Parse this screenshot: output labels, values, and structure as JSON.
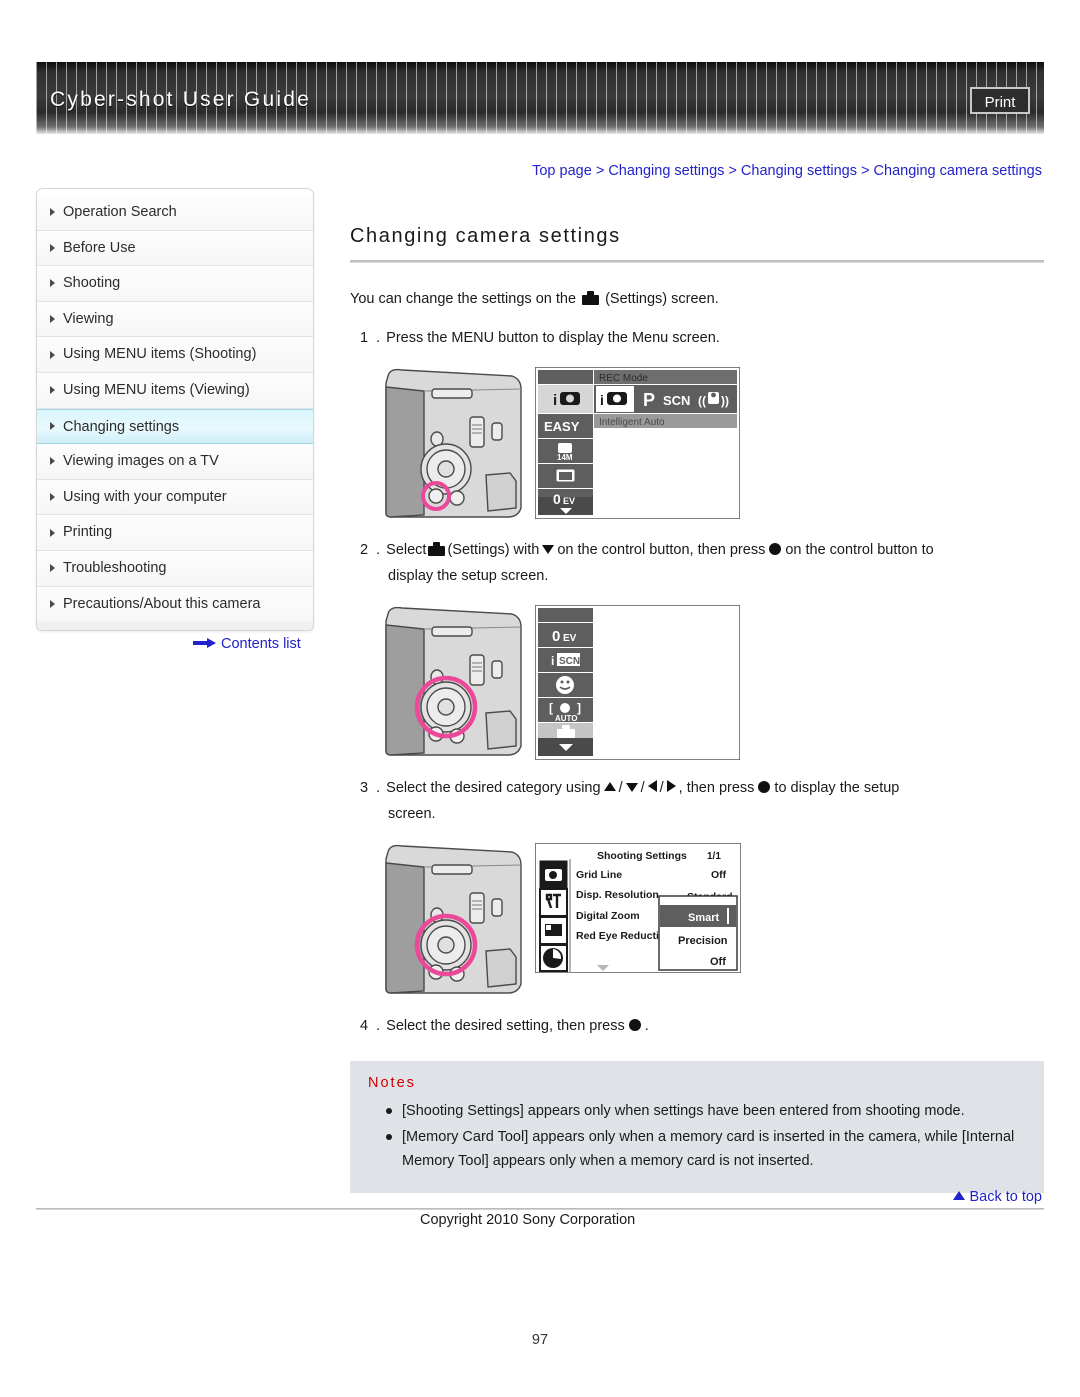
{
  "header": {
    "title": "Cyber-shot User Guide",
    "print_label": "Print"
  },
  "breadcrumb": {
    "items": [
      "Top page",
      "Changing settings",
      "Changing settings",
      "Changing camera settings"
    ],
    "separator": ">",
    "full_text": "Top page > Changing settings > Changing settings > Changing camera settings"
  },
  "sidebar": {
    "items": [
      {
        "label": "Operation Search",
        "active": false
      },
      {
        "label": "Before Use",
        "active": false
      },
      {
        "label": "Shooting",
        "active": false
      },
      {
        "label": "Viewing",
        "active": false
      },
      {
        "label": "Using MENU items (Shooting)",
        "active": false
      },
      {
        "label": "Using MENU items (Viewing)",
        "active": false
      },
      {
        "label": "Changing settings",
        "active": true
      },
      {
        "label": "Viewing images on a TV",
        "active": false
      },
      {
        "label": "Using with your computer",
        "active": false
      },
      {
        "label": "Printing",
        "active": false
      },
      {
        "label": "Troubleshooting",
        "active": false
      },
      {
        "label": "Precautions/About this camera",
        "active": false
      }
    ],
    "contents_link": "Contents list"
  },
  "main": {
    "title": "Changing camera settings",
    "intro_before": "You can change the settings on the",
    "intro_after": "(Settings) screen.",
    "steps": {
      "s1_num": "1 .",
      "s1_text": "Press the MENU button to display the Menu screen.",
      "s2_num": "2 .",
      "s2_a": "Select",
      "s2_b": "(Settings) with",
      "s2_c": "on the control button, then press",
      "s2_d": "on the control button to",
      "s2_line2": "display the setup screen.",
      "s3_num": "3 .",
      "s3_a": "Select the desired category using",
      "s3_b": ", then press",
      "s3_c": "to display the setup",
      "s3_line2": "screen.",
      "s4_num": "4 .",
      "s4_a": "Select the desired setting, then press",
      "s4_b": "."
    }
  },
  "figure1": {
    "menu_left_items": [
      "iA",
      "EASY",
      "14M",
      "display",
      "0EV",
      "down"
    ],
    "top_label": "REC Mode",
    "mode_icons": [
      "iA",
      "P",
      "SCN",
      "anti-blur"
    ],
    "sub_label": "Intelligent Auto",
    "highlight_color": "#ec4899"
  },
  "figure2": {
    "menu_left_items": [
      "0EV",
      "iSCN",
      "smile",
      "auto-frame",
      "settings",
      "down"
    ],
    "selected_index": 4,
    "highlight_color": "#ec4899"
  },
  "figure3": {
    "screen_title": "Shooting Settings",
    "page_indicator": "1/1",
    "rows": [
      {
        "label": "Grid Line",
        "value": "Off"
      },
      {
        "label": "Disp. Resolution",
        "value": "Standard"
      },
      {
        "label": "Digital Zoom",
        "value": ""
      },
      {
        "label": "Red Eye Reducti",
        "value": ""
      }
    ],
    "dropdown_options": [
      "Smart",
      "Precision",
      "Off"
    ],
    "dropdown_selected": "Smart",
    "category_icons": [
      "camera-settings-icon",
      "main-settings-icon",
      "memory-card-tool-icon",
      "clock-settings-icon"
    ],
    "highlight_color": "#ec4899"
  },
  "notes": {
    "title": "Notes",
    "items": [
      "[Shooting Settings] appears only when settings have been entered from shooting mode.",
      "[Memory Card Tool] appears only when a memory card is inserted in the camera, while [Internal Memory Tool] appears only when a memory card is not inserted."
    ]
  },
  "footer": {
    "back_to_top": "Back to top",
    "copyright": "Copyright 2010 Sony Corporation",
    "page_number": "97"
  }
}
